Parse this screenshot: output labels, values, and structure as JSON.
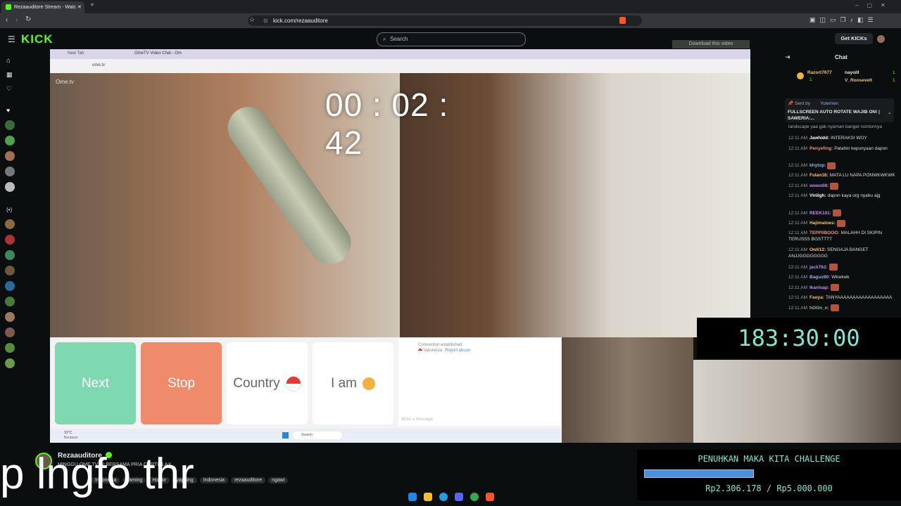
{
  "browser": {
    "tab_title": "Rezaauditore Stream - Watch",
    "url": "kick.com/rezaauditore"
  },
  "kick": {
    "logo": "KICK",
    "search_placeholder": "Search",
    "get_kicks": "Get KICKs",
    "download_label": "Download this video"
  },
  "stream": {
    "inner_tabs": [
      "New Tab",
      "OmeTV Video Chat - Om"
    ],
    "inner_url": "ome.tv",
    "ometv_logo": "Ome.tv",
    "timer": "00 : 02 : 42",
    "buttons": {
      "next": "Next",
      "stop": "Stop",
      "country": "Country",
      "iam": "I am"
    },
    "chat_status": "Connection established.",
    "chat_location": "Indonesia",
    "chat_report": "Report abuse",
    "message_placeholder": "Write a message",
    "temperature": "31°C",
    "weather": "Berawan",
    "taskbar_search": "Search"
  },
  "countdown": "183:30:00",
  "chat": {
    "title": "Chat",
    "top_supporters": [
      {
        "name": "Razort7677",
        "value": "1"
      },
      {
        "name": "nayolll",
        "value": "1"
      },
      {
        "name": "V_Roosevelt",
        "value": "1"
      }
    ],
    "pinned_sender_label": "Sent by",
    "pinned_sender": "Yuteriren",
    "pinned_text": "FULLSCREEN AUTO ROTATE WAJIB ON! | SAWERIA:...",
    "partial_top": "landscape yaa gak nyaman banget nontonnya",
    "messages": [
      {
        "time": "12:11 AM",
        "user": "Jawhidd:",
        "text": "INTERAKSI WOY",
        "color": "#ffffff"
      },
      {
        "time": "12:11 AM",
        "user": "Penyefing:",
        "text": "Patahin kepunyaan dapon",
        "color": "#f28b82"
      },
      {
        "time": "12:11 AM",
        "user": "khytop:",
        "text": "",
        "color": "#8ab4f8"
      },
      {
        "time": "12:11 AM",
        "user": "Fulan18:",
        "text": "MATA LU NAPA PONWKWKWK",
        "color": "#f6c26b"
      },
      {
        "time": "12:11 AM",
        "user": "wowo08:",
        "text": "",
        "color": "#c58af9"
      },
      {
        "time": "12:11 AM",
        "user": "Vinligh:",
        "text": "dapon kaya org nyabu ajg",
        "color": "#ffffff"
      },
      {
        "time": "12:11 AM",
        "user": "REEK101:",
        "text": "",
        "color": "#c58af9"
      },
      {
        "time": "12:11 AM",
        "user": "Hajimatoes:",
        "text": "",
        "color": "#f6c26b"
      },
      {
        "time": "12:11 AM",
        "user": "TEPPIIBOOO:",
        "text": "MALAHH DI SKIPIN TERUSSS BGSTTTT",
        "color": "#f28b82"
      },
      {
        "time": "12:11 AM",
        "user": "Owli12:",
        "text": "SENGAJA BANGET ANJJGGGGGGGG",
        "color": "#f6c26b"
      },
      {
        "time": "12:11 AM",
        "user": "jack763:",
        "text": "",
        "color": "#c58af9"
      },
      {
        "time": "12:11 AM",
        "user": "Bagus90:",
        "text": "Wkwkwk",
        "color": "#8ab4f8"
      },
      {
        "time": "12:11 AM",
        "user": "Ikanlsap:",
        "text": "",
        "color": "#c58af9"
      },
      {
        "time": "12:11 AM",
        "user": "Faoya:",
        "text": "TANYAAAAAAAAAAAAAAAAAA",
        "color": "#f6c26b"
      },
      {
        "time": "12:11 AM",
        "user": "hOOn_n:",
        "text": "",
        "color": "#81c995"
      }
    ]
  },
  "channel": {
    "name": "Rezaauditore",
    "stream_title": "MINGGU OME TV DI BERSAMA PRIA CURTISLAX",
    "tags": [
      "Indonesia",
      "gaming",
      "Horror",
      "yapping",
      "Indonesia",
      "rezaauditore",
      "ngawi"
    ],
    "partial_tags": [
      "Just Ro...",
      "..."
    ]
  },
  "overlay_subtitle": "p lngfo thr",
  "challenge": {
    "title": "PENUHKAN MAKA KITA CHALLENGE",
    "amount_text": "Rp2.306.178 / Rp5.000.000",
    "progress": 0.46
  },
  "colors": {
    "kick_green": "#53fc18",
    "next_button": "#7ed9b0",
    "stop_button": "#ef8a6b",
    "countdown_text": "#7ee7d4",
    "progress_bar": "#4a90d9"
  }
}
